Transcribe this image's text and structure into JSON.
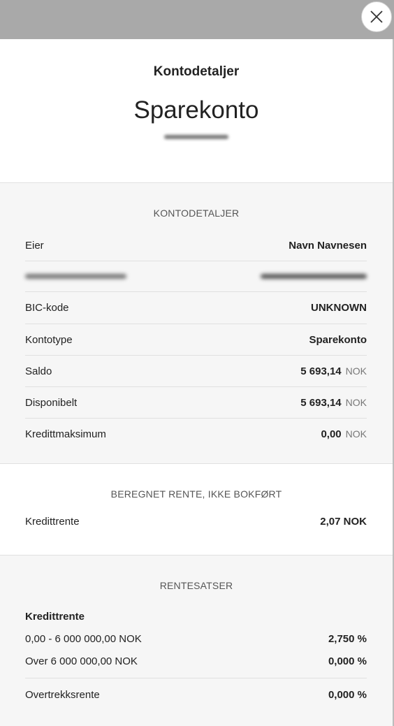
{
  "header": {
    "subtitle": "Kontodetaljer",
    "title": "Sparekonto"
  },
  "account_details": {
    "section_title": "KONTODETALJER",
    "rows": [
      {
        "label": "Eier",
        "value": "Navn Navnesen"
      },
      {
        "label": "BIC-kode",
        "value": "UNKNOWN"
      },
      {
        "label": "Kontotype",
        "value": "Sparekonto"
      },
      {
        "label": "Saldo",
        "value": "5 693,14",
        "currency": "NOK"
      },
      {
        "label": "Disponibelt",
        "value": "5 693,14",
        "currency": "NOK"
      },
      {
        "label": "Kredittmaksimum",
        "value": "0,00",
        "currency": "NOK"
      }
    ]
  },
  "calculated_interest": {
    "section_title": "BEREGNET RENTE, IKKE BOKFØRT",
    "label": "Kredittrente",
    "value": "2,07 NOK"
  },
  "interest_rates": {
    "section_title": "RENTESATSER",
    "group_title": "Kredittrente",
    "tiers": [
      {
        "label": "0,00 - 6 000 000,00 NOK",
        "value": "2,750 %"
      },
      {
        "label": "Over 6 000 000,00 NOK",
        "value": "0,000 %"
      }
    ],
    "overdraft": {
      "label": "Overtrekksrente",
      "value": "0,000 %"
    }
  },
  "icons": {
    "close": "close-icon"
  }
}
